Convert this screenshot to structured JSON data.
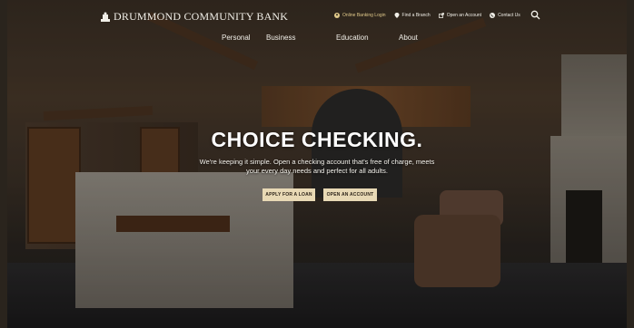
{
  "brand": {
    "name": "DRUMMOND COMMUNITY BANK"
  },
  "utility_nav": {
    "online_banking": "Online Banking Login",
    "find_branch": "Find a Branch",
    "open_account": "Open an Account",
    "contact": "Contact Us"
  },
  "main_nav": [
    "Personal",
    "Business",
    "Education",
    "About"
  ],
  "hero": {
    "title": "CHOICE CHECKING.",
    "subtitle_line1": "We're keeping it simple. Open a checking account that's free of charge, meets",
    "subtitle_line2": "your every day needs and perfect for all adults.",
    "primary_cta": "APPLY FOR A LOAN",
    "secondary_cta": "OPEN AN ACCOUNT"
  },
  "colors": {
    "accent": "#e8d9b5",
    "gold_link": "#e0c98a",
    "text_light": "#f1efe8"
  }
}
